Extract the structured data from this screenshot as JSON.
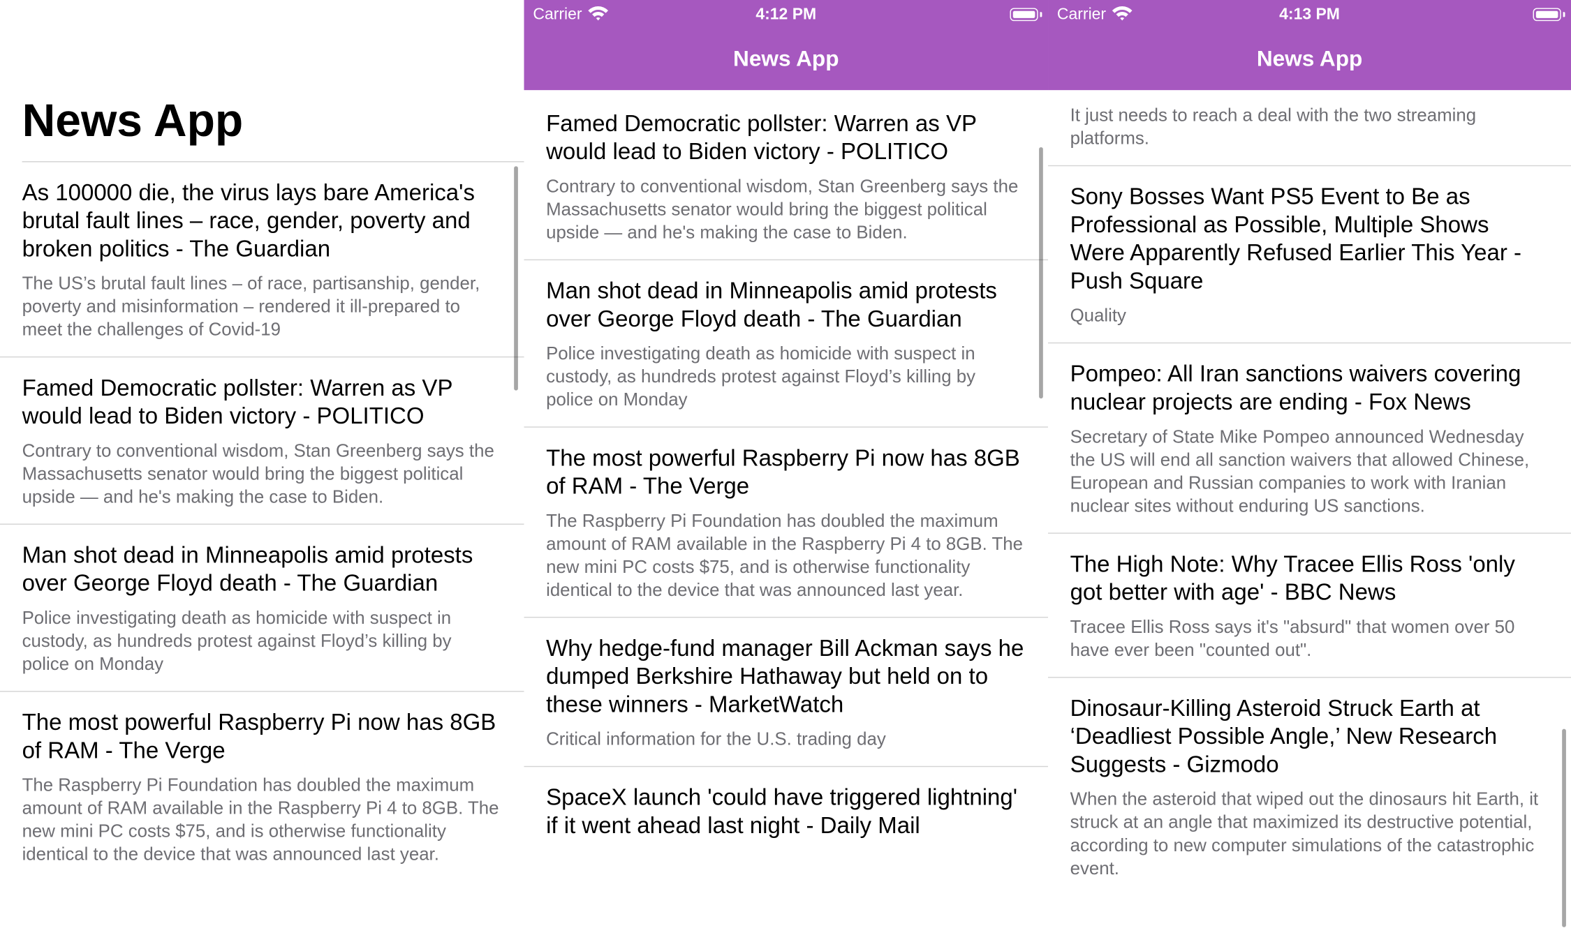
{
  "app": {
    "title": "News App"
  },
  "status_bar": {
    "left": {
      "carrier": "Carrier",
      "time": "4:12 PM"
    },
    "right": {
      "carrier": "Carrier",
      "time": "4:13 PM"
    }
  },
  "colors": {
    "nav_bar": "#a658bf",
    "separator": "#d4d4d4",
    "description": "#6e6e73"
  },
  "icons": [
    "wifi-icon",
    "battery-icon"
  ],
  "panel1": {
    "large_title": "News App",
    "articles": [
      {
        "headline": "As 100000 die, the virus lays bare America's brutal fault lines – race, gender, poverty and broken politics - The Guardian",
        "description": "The US’s brutal fault lines – of race, partisanship, gender, poverty and misinformation – rendered it ill-prepared to meet the challenges of Covid-19"
      },
      {
        "headline": "Famed Democratic pollster: Warren as VP would lead to Biden victory - POLITICO",
        "description": "Contrary to conventional wisdom, Stan Greenberg says the Massachusetts senator would bring the biggest political upside — and he's making the case to Biden."
      },
      {
        "headline": "Man shot dead in Minneapolis amid protests over George Floyd death - The Guardian",
        "description": "Police investigating death as homicide with suspect in custody, as hundreds protest against Floyd’s killing by police on Monday"
      },
      {
        "headline": "The most powerful Raspberry Pi now has 8GB of RAM - The Verge",
        "description": "The Raspberry Pi Foundation has doubled the maximum amount of RAM available in the Raspberry Pi 4 to 8GB. The new mini PC costs $75, and is otherwise functionality identical to the device that was announced last year."
      }
    ]
  },
  "panel2": {
    "nav_title": "News App",
    "articles": [
      {
        "headline": "Famed Democratic pollster: Warren as VP would lead to Biden victory - POLITICO",
        "description": "Contrary to conventional wisdom, Stan Greenberg says the Massachusetts senator would bring the biggest political upside — and he's making the case to Biden."
      },
      {
        "headline": "Man shot dead in Minneapolis amid protests over George Floyd death - The Guardian",
        "description": "Police investigating death as homicide with suspect in custody, as hundreds protest against Floyd’s killing by police on Monday"
      },
      {
        "headline": "The most powerful Raspberry Pi now has 8GB of RAM - The Verge",
        "description": "The Raspberry Pi Foundation has doubled the maximum amount of RAM available in the Raspberry Pi 4 to 8GB. The new mini PC costs $75, and is otherwise functionality identical to the device that was announced last year."
      },
      {
        "headline": "Why hedge-fund manager Bill Ackman says he dumped Berkshire Hathaway but held on to these winners - MarketWatch",
        "description": "Critical information for the U.S. trading day"
      },
      {
        "headline": "SpaceX launch 'could have triggered lightning' if it went ahead last night - Daily Mail"
      }
    ]
  },
  "panel3": {
    "nav_title": "News App",
    "partial_description": "It just needs to reach a deal with the two streaming platforms.",
    "articles": [
      {
        "headline": "Sony Bosses Want PS5 Event to Be as Professional as Possible, Multiple Shows Were Apparently Refused Earlier This Year - Push Square",
        "description": "Quality"
      },
      {
        "headline": "Pompeo: All Iran sanctions waivers covering nuclear projects are ending - Fox News",
        "description": "Secretary of State Mike Pompeo announced Wednesday the US will end all sanction waivers that allowed Chinese, European and Russian companies to work with Iranian nuclear sites without enduring US sanctions."
      },
      {
        "headline": "The High Note: Why Tracee Ellis Ross 'only got better with age' - BBC News",
        "description": "Tracee Ellis Ross says it's \"absurd\" that women over 50 have ever been \"counted out\"."
      },
      {
        "headline": "Dinosaur-Killing Asteroid Struck Earth at ‘Deadliest Possible Angle,’ New Research Suggests - Gizmodo",
        "description": "When the asteroid that wiped out the dinosaurs hit Earth, it struck at an angle that maximized its destructive potential, according to new computer simulations of the catastrophic event."
      }
    ]
  }
}
